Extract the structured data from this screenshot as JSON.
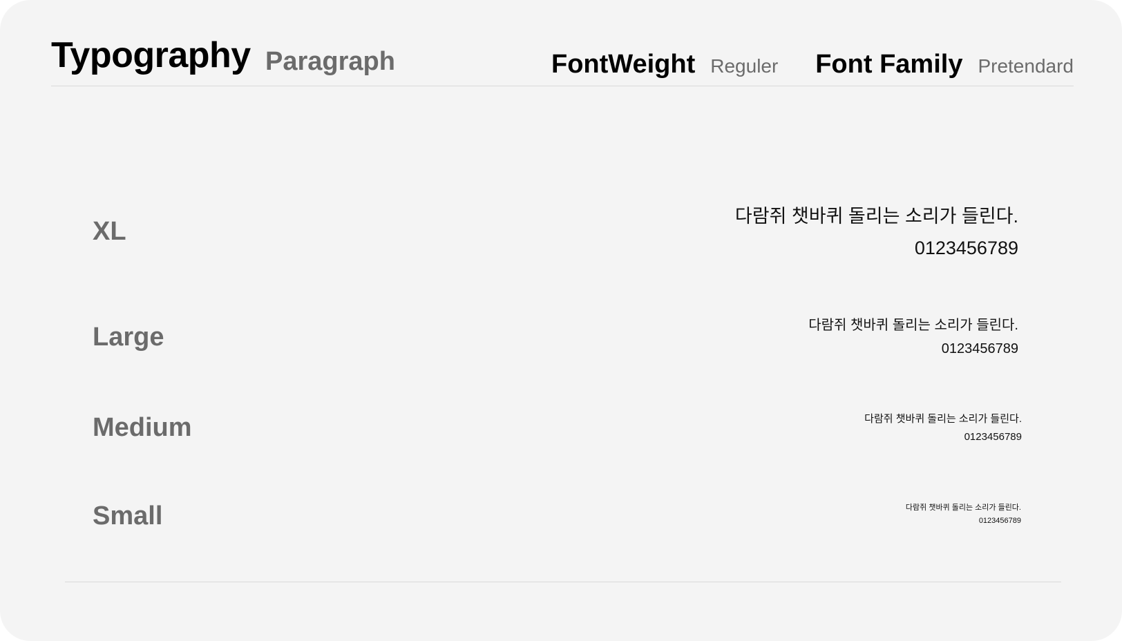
{
  "header": {
    "title": "Typography",
    "subtitle": "Paragraph",
    "font_weight_label": "FontWeight",
    "font_weight_value": "Reguler",
    "font_family_label": "Font Family",
    "font_family_value": "Pretendard"
  },
  "rows": [
    {
      "label": "XL",
      "sample_text": "다람쥐 챗바퀴 돌리는 소리가 들린다.",
      "sample_digits": "0123456789"
    },
    {
      "label": "Large",
      "sample_text": "다람쥐 챗바퀴 돌리는 소리가 들린다.",
      "sample_digits": "0123456789"
    },
    {
      "label": "Medium",
      "sample_text": "다람쥐 챗바퀴 돌리는 소리가 들린다.",
      "sample_digits": "0123456789"
    },
    {
      "label": "Small",
      "sample_text": "다람쥐 챗바퀴 돌리는 소리가 들린다.",
      "sample_digits": "0123456789"
    }
  ],
  "colors": {
    "background": "#f4f4f4",
    "heading": "#000000",
    "muted": "#6b6b6b",
    "divider": "#d9d9d9"
  }
}
